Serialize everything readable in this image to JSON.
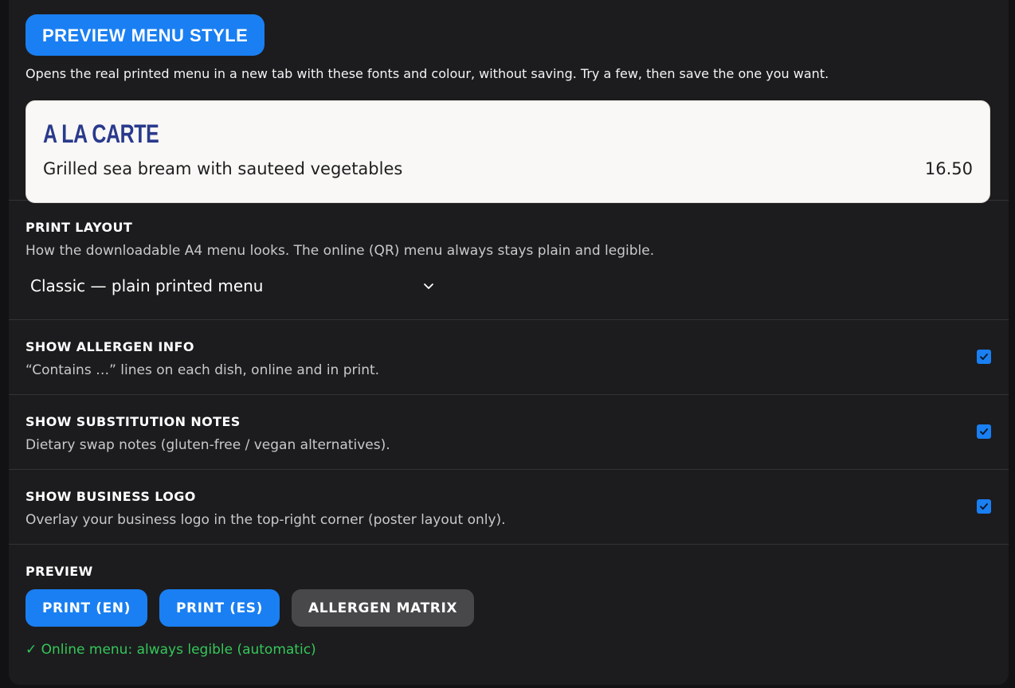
{
  "top": {
    "preview_button": "PREVIEW MENU STYLE",
    "intro": "Opens the real printed menu in a new tab with these fonts and colour, without saving. Try a few, then save the one you want."
  },
  "sample": {
    "heading": "A LA CARTE",
    "dish": "Grilled sea bream with sauteed vegetables",
    "price": "16.50"
  },
  "print_layout": {
    "title": "PRINT LAYOUT",
    "description": "How the downloadable A4 menu looks. The online (QR) menu always stays plain and legible.",
    "selected": "Classic — plain printed menu"
  },
  "toggles": [
    {
      "title": "SHOW ALLERGEN INFO",
      "description": "“Contains …” lines on each dish, online and in print.",
      "checked": true
    },
    {
      "title": "SHOW SUBSTITUTION NOTES",
      "description": "Dietary swap notes (gluten-free / vegan alternatives).",
      "checked": true
    },
    {
      "title": "SHOW BUSINESS LOGO",
      "description": "Overlay your business logo in the top-right corner (poster layout only).",
      "checked": true
    }
  ],
  "preview": {
    "title": "PREVIEW",
    "buttons": [
      "PRINT (EN)",
      "PRINT (ES)",
      "ALLERGEN MATRIX"
    ],
    "status": "✓ Online menu: always legible (automatic)"
  },
  "colors": {
    "accent": "#1a7ff2",
    "success": "#34c759",
    "sample_heading": "#2a3a8c"
  },
  "icons": {
    "select": "chevron-down-icon",
    "toggle": "checkmark-icon"
  }
}
